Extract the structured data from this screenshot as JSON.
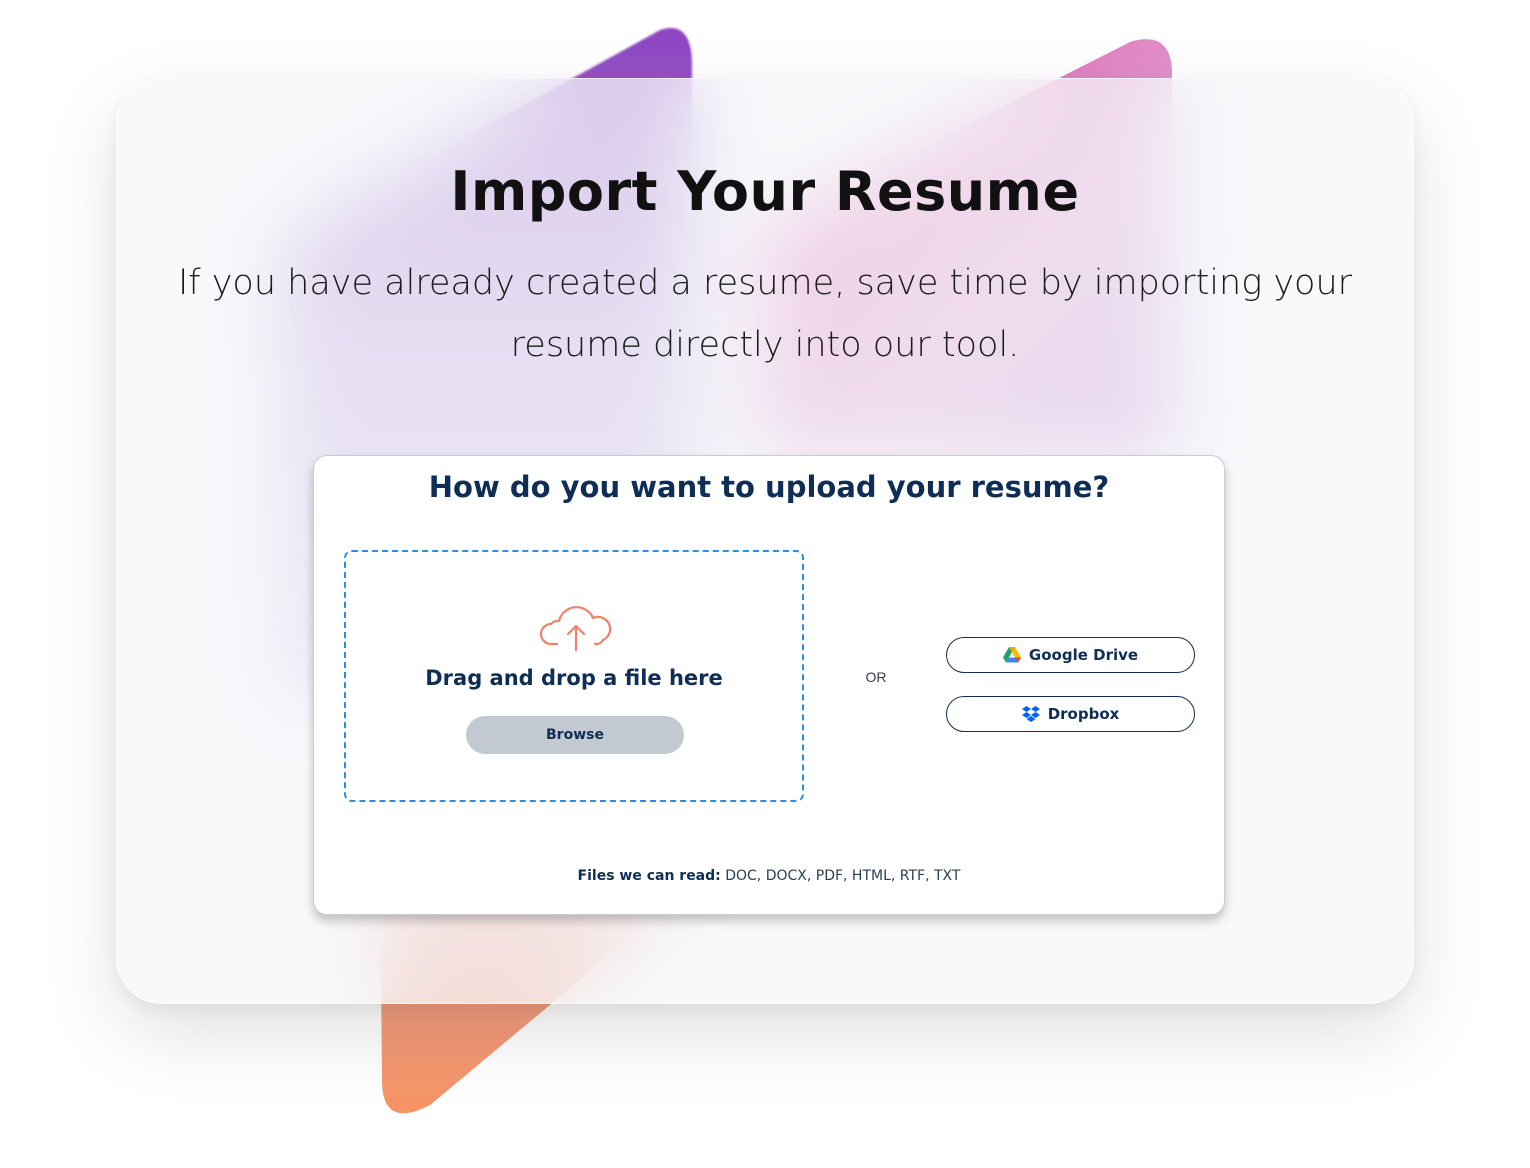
{
  "header": {
    "title": "Import Your Resume",
    "subtitle": "If you have already created a resume, save time by importing your resume directly into our tool."
  },
  "upload": {
    "question": "How do you want to upload your resume?",
    "dropzone_text": "Drag and drop a file here",
    "browse_label": "Browse",
    "or_label": "OR",
    "google_drive_label": "Google Drive",
    "dropbox_label": "Dropbox",
    "file_types_label": "Files we can read:",
    "file_types_list": "DOC, DOCX, PDF, HTML, RTF, TXT"
  },
  "icons": {
    "upload": "cloud-upload-icon",
    "google_drive": "google-drive-icon",
    "dropbox": "dropbox-icon"
  },
  "colors": {
    "primary_text": "#0e2e56",
    "dropzone_border": "#2a8fe3",
    "upload_icon": "#f0826a",
    "browse_bg": "#c2c9d1",
    "deco_purple": "#8f4cc4",
    "deco_pink": "#e2519f",
    "deco_orange": "#f6955c"
  }
}
